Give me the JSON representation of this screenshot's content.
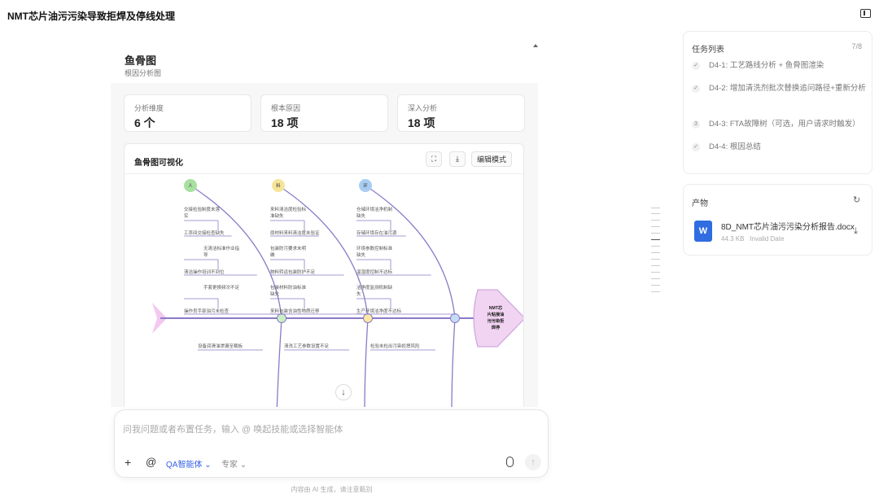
{
  "header": {
    "title": "NMT芯片油污污染导致拒焊及停线处理"
  },
  "card": {
    "title": "鱼骨图",
    "subtitle": "根因分析图",
    "stats": [
      {
        "label": "分析维度",
        "value": "6 个"
      },
      {
        "label": "根本原因",
        "value": "18 项"
      },
      {
        "label": "深入分析",
        "value": "18 项"
      }
    ],
    "viz_title": "鱼骨图可视化",
    "edit_mode_label": "编辑模式"
  },
  "fishbone": {
    "head_label": "NMT芯片粘接油污污染拒焊停",
    "categories_top": [
      {
        "name": "人",
        "color": "#a8e0a0",
        "causes": [
          {
            "main": "工序间交接检查缺失",
            "sub": "交接检验制度未落实"
          },
          {
            "main": "清洁操作培训不到位",
            "sub": "无清洁标准作业指导"
          },
          {
            "main": "操作员手部油污未检查",
            "sub": "手套更换频次不足"
          }
        ]
      },
      {
        "name": "料",
        "color": "#f5e49a",
        "causes": [
          {
            "main": "原材料来料清洁度未验证",
            "sub": "来料清洁度检验标准缺失"
          },
          {
            "main": "物料转运包装防护不足",
            "sub": "包装防污要求未明确"
          },
          {
            "main": "来料包装含油性物质迁移",
            "sub": "包装材料防油标准缺失"
          }
        ]
      },
      {
        "name": "环",
        "color": "#a9cdf2",
        "causes": [
          {
            "main": "存储环境存在油污源",
            "sub": "仓储环境洁净机制缺失"
          },
          {
            "main": "温湿度控制不达标",
            "sub": "环境参数控制标准缺失"
          },
          {
            "main": "生产环境洁净度不达标",
            "sub": "洁净度监测机制缺失"
          }
        ]
      }
    ],
    "categories_bottom": [
      {
        "main": "设备润滑油渗漏至载板"
      },
      {
        "main": "清洗工艺参数设置不足"
      },
      {
        "main": "检验未检出污染拒焊风险"
      }
    ]
  },
  "input": {
    "placeholder": "问我问题或者布置任务，输入 @ 唤起技能或选择智能体",
    "agent_label": "QA智能体",
    "expert_label": "专家",
    "disclaimer": "内容由 AI 生成，请注意甄别"
  },
  "tasks": {
    "title": "任务列表",
    "count": "7/8",
    "items": [
      {
        "mark": "✓",
        "text": "D4-1: 工艺路线分析 + 鱼骨图渲染"
      },
      {
        "mark": "✓",
        "text": "D4-2: 增加清洗剂批次替换追问路径+重新分析"
      },
      {
        "mark": "3",
        "text": "D4-3: FTA故障树（可选，用户请求时触发）"
      },
      {
        "mark": "✓",
        "text": "D4-4: 根因总结"
      }
    ]
  },
  "artifacts": {
    "title": "产物",
    "file_name": "8D_NMT芯片油污污染分析报告.docx",
    "file_size": "44.3 KB",
    "file_date": "Invalid Date",
    "file_icon": "W"
  }
}
